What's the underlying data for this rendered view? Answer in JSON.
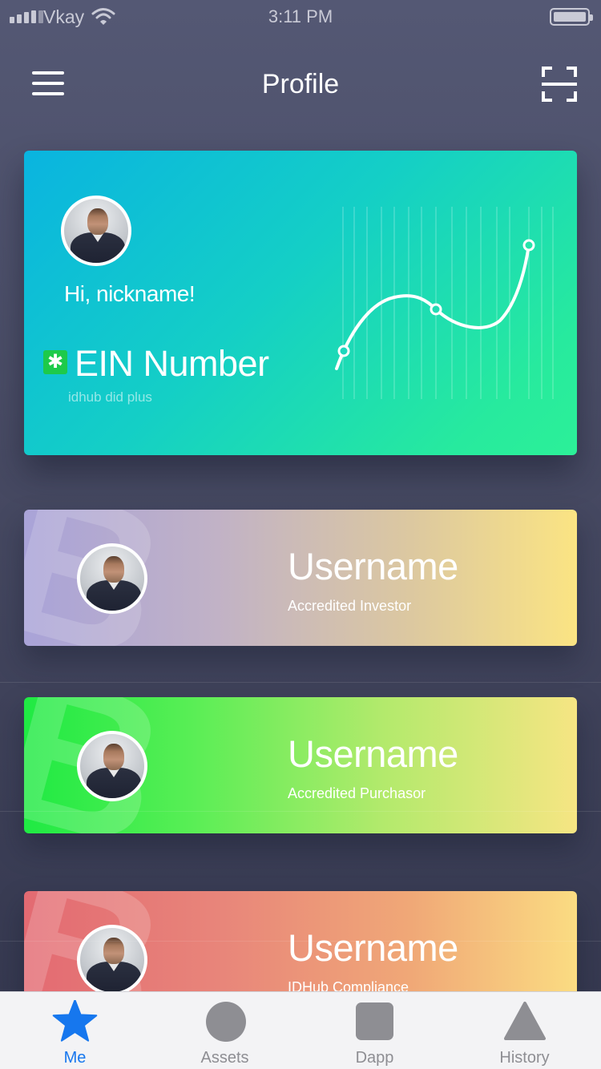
{
  "status_bar": {
    "carrier": "Vkay",
    "time": "3:11 PM"
  },
  "nav": {
    "title": "Profile",
    "menu_icon": "hamburger-menu-icon",
    "scan_icon": "scan-frame-icon"
  },
  "profile_card": {
    "greeting": "Hi, nickname!",
    "ein_title": "EIN Number",
    "ein_subtitle": "idhub did plus",
    "ein_icon": "asterisk-badge-icon",
    "gradient": [
      "#0ab4e0",
      "#2cf098"
    ]
  },
  "cards": [
    {
      "name": "Username",
      "role": "Accredited Investor",
      "colors": [
        "#a9a3d8",
        "#fbe483"
      ]
    },
    {
      "name": "Username",
      "role": "Accredited Purchasor",
      "colors": [
        "#1fea43",
        "#f6e583"
      ]
    },
    {
      "name": "Username",
      "role": "IDHub Compliance",
      "colors": [
        "#e36a72",
        "#fbdc82"
      ]
    }
  ],
  "tabs": [
    {
      "label": "Me",
      "icon": "star-icon",
      "active": true,
      "color": "#1677ee"
    },
    {
      "label": "Assets",
      "icon": "circle-icon",
      "active": false,
      "color": "#8e8e93"
    },
    {
      "label": "Dapp",
      "icon": "square-icon",
      "active": false,
      "color": "#8e8e93"
    },
    {
      "label": "History",
      "icon": "triangle-icon",
      "active": false,
      "color": "#8e8e93"
    }
  ]
}
